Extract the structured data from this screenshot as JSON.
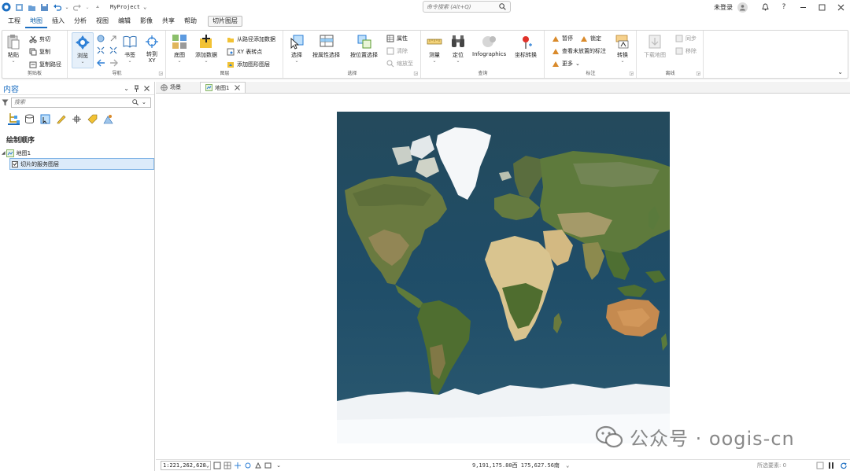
{
  "titlebar": {
    "project_name": "MyProject",
    "command_search_placeholder": "命令搜索 (Alt+Q)",
    "signin_label": "未登录",
    "help_glyph": "?"
  },
  "menu_tabs": [
    "工程",
    "地图",
    "插入",
    "分析",
    "视图",
    "编辑",
    "影像",
    "共享",
    "帮助"
  ],
  "active_tab": "地图",
  "context_tab": "切片图层",
  "ribbon": {
    "clipboard": {
      "group": "剪贴板",
      "paste": "粘贴",
      "cut": "剪切",
      "copy": "复制",
      "copy_path": "复制路径"
    },
    "navigate": {
      "group": "导航",
      "explore": "浏览",
      "bookmarks": "书签",
      "goto_xy": "转到\nXY"
    },
    "layer": {
      "group": "图层",
      "basemap": "底图",
      "add_data": "添加数据",
      "add_from_path": "从路径添加数据",
      "xy_to_point": "XY 表转点",
      "add_graphics_layer": "添加图形图层"
    },
    "selection": {
      "group": "选择",
      "select": "选择",
      "select_by_attr": "按属性选择",
      "select_by_loc": "按位置选择",
      "attributes": "属性",
      "clear": "清除",
      "zoom_to": "缩放至"
    },
    "inquiry": {
      "group": "查询",
      "measure": "测量",
      "locate": "定位",
      "infographics": "Infographics",
      "coord_convert": "坐标转换"
    },
    "labeling": {
      "group": "标注",
      "pause": "暂停",
      "lock": "锁定",
      "view_unplaced": "查看未放置的标注",
      "more": "更多",
      "convert": "转换"
    },
    "offline": {
      "group": "离线",
      "download_map": "下载地图",
      "sync": "同步",
      "remove": "移除"
    }
  },
  "contents": {
    "title": "内容",
    "search_placeholder": "搜索",
    "drawing_order": "绘制顺序",
    "map_name": "地图1",
    "layer_name": "切片的服务图层"
  },
  "view_tabs": [
    {
      "label": "场景",
      "active": false
    },
    {
      "label": "地图1",
      "active": true
    }
  ],
  "status": {
    "scale": "1:221,262,628",
    "coordinates": "9,191,175.80西  175,627.56南",
    "selected_features": "所选要素: 0"
  },
  "watermark": {
    "text": "公众号 · oogis-cn"
  },
  "colors": {
    "accent": "#1b6ec2",
    "ocean": "#1f4c66",
    "land": "#6f7a3e",
    "desert": "#d8c391",
    "ice": "#f4f6f8"
  }
}
